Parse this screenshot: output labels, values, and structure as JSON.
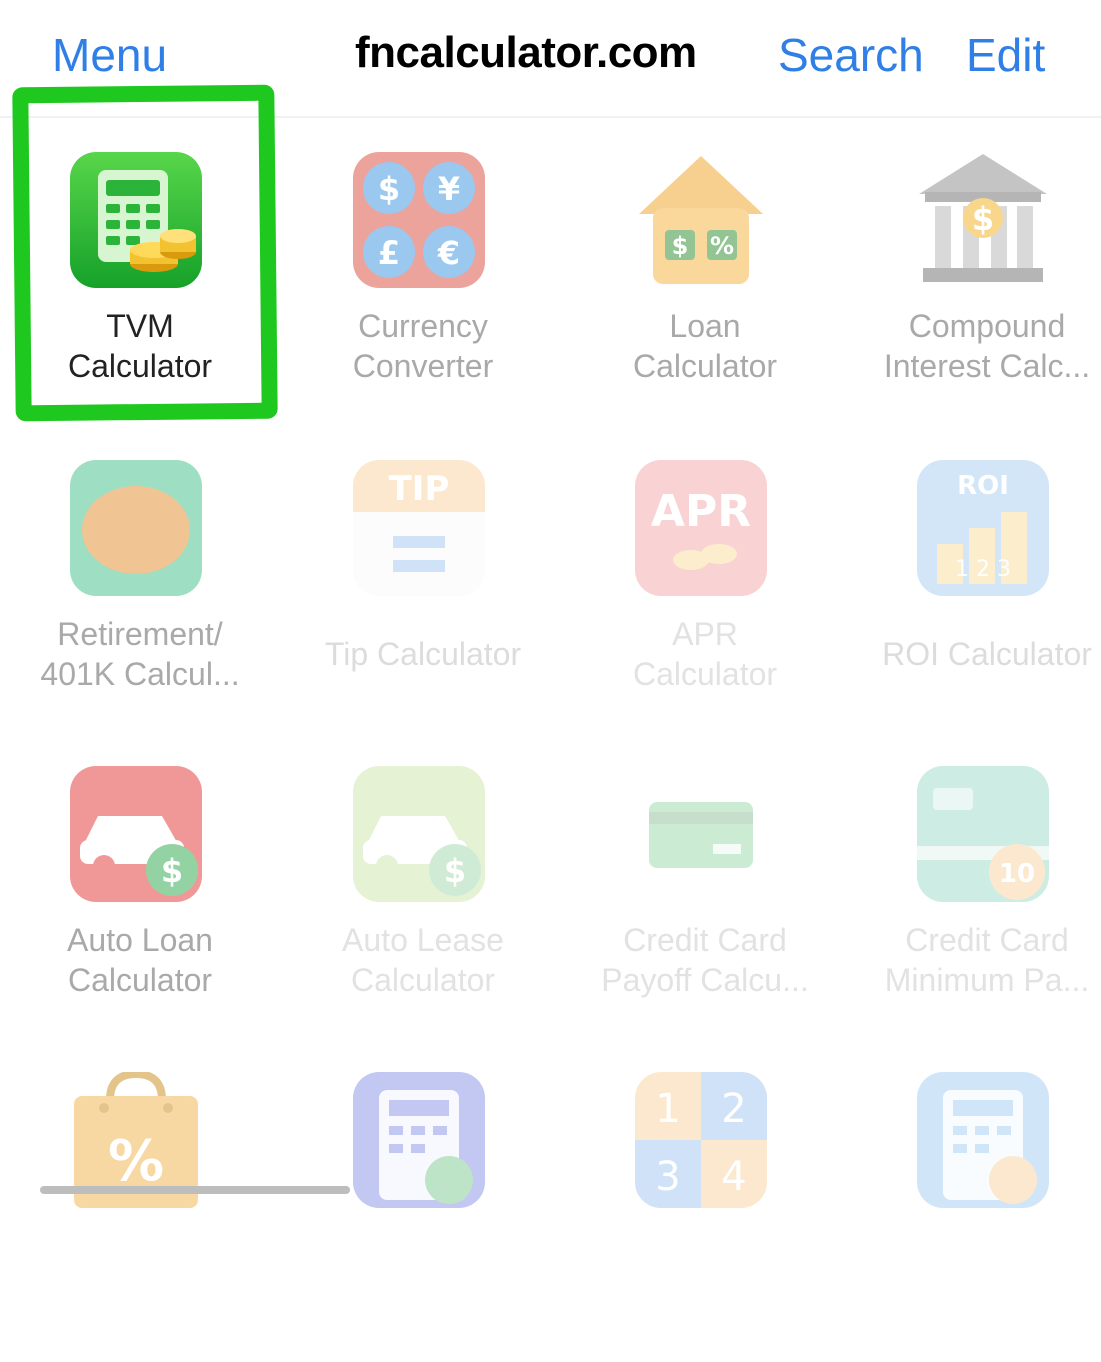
{
  "nav": {
    "menu_label": "Menu",
    "title": "fncalculator.com",
    "search_label": "Search",
    "edit_label": "Edit"
  },
  "colors": {
    "link": "#2f7fe6",
    "highlight": "#1fc81f"
  },
  "apps": [
    {
      "name": "tvm-calculator",
      "label": "TVM\nCalculator",
      "icon": "calculator-coins-icon"
    },
    {
      "name": "currency-converter",
      "label": "Currency\nConverter",
      "icon": "currency-icon"
    },
    {
      "name": "loan-calculator",
      "label": "Loan\nCalculator",
      "icon": "house-icon"
    },
    {
      "name": "compound-interest-calculator",
      "label": "Compound\nInterest Calc...",
      "icon": "bank-icon"
    },
    {
      "name": "retirement-calculator",
      "label": "Retirement/\n401K Calcul...",
      "icon": "egg-icon"
    },
    {
      "name": "tip-calculator",
      "label": "Tip Calculator",
      "icon": "tip-icon"
    },
    {
      "name": "apr-calculator",
      "label": "APR\nCalculator",
      "icon": "apr-icon"
    },
    {
      "name": "roi-calculator",
      "label": "ROI Calculator",
      "icon": "roi-chart-icon"
    },
    {
      "name": "auto-loan-calculator",
      "label": "Auto Loan\nCalculator",
      "icon": "car-dollar-icon"
    },
    {
      "name": "auto-lease-calculator",
      "label": "Auto Lease\nCalculator",
      "icon": "car-lease-icon"
    },
    {
      "name": "credit-card-payoff-calculator",
      "label": "Credit Card\nPayoff Calcu...",
      "icon": "credit-card-icon"
    },
    {
      "name": "credit-card-minimum-payment-calculator",
      "label": "Credit Card\nMinimum Pa...",
      "icon": "credit-card-minimum-icon"
    },
    {
      "name": "discount-calculator",
      "label": "",
      "icon": "shopping-bag-percent-icon"
    },
    {
      "name": "salary-calculator",
      "label": "",
      "icon": "calculator-dollar-icon"
    },
    {
      "name": "number-calculator",
      "label": "",
      "icon": "number-grid-icon"
    },
    {
      "name": "percent-calculator",
      "label": "",
      "icon": "calculator-percent-icon"
    }
  ],
  "icon_text": {
    "currency": [
      "$",
      "¥",
      "£",
      "€"
    ],
    "loan": [
      "$",
      "%"
    ],
    "bank": "$",
    "tip": "TIP",
    "apr": "APR",
    "roi_title": "ROI",
    "roi_digits": "1 2 3",
    "auto_dollar": "$",
    "card_min": "10",
    "discount": "%",
    "number_grid": [
      "1",
      "2",
      "3",
      "4"
    ]
  }
}
